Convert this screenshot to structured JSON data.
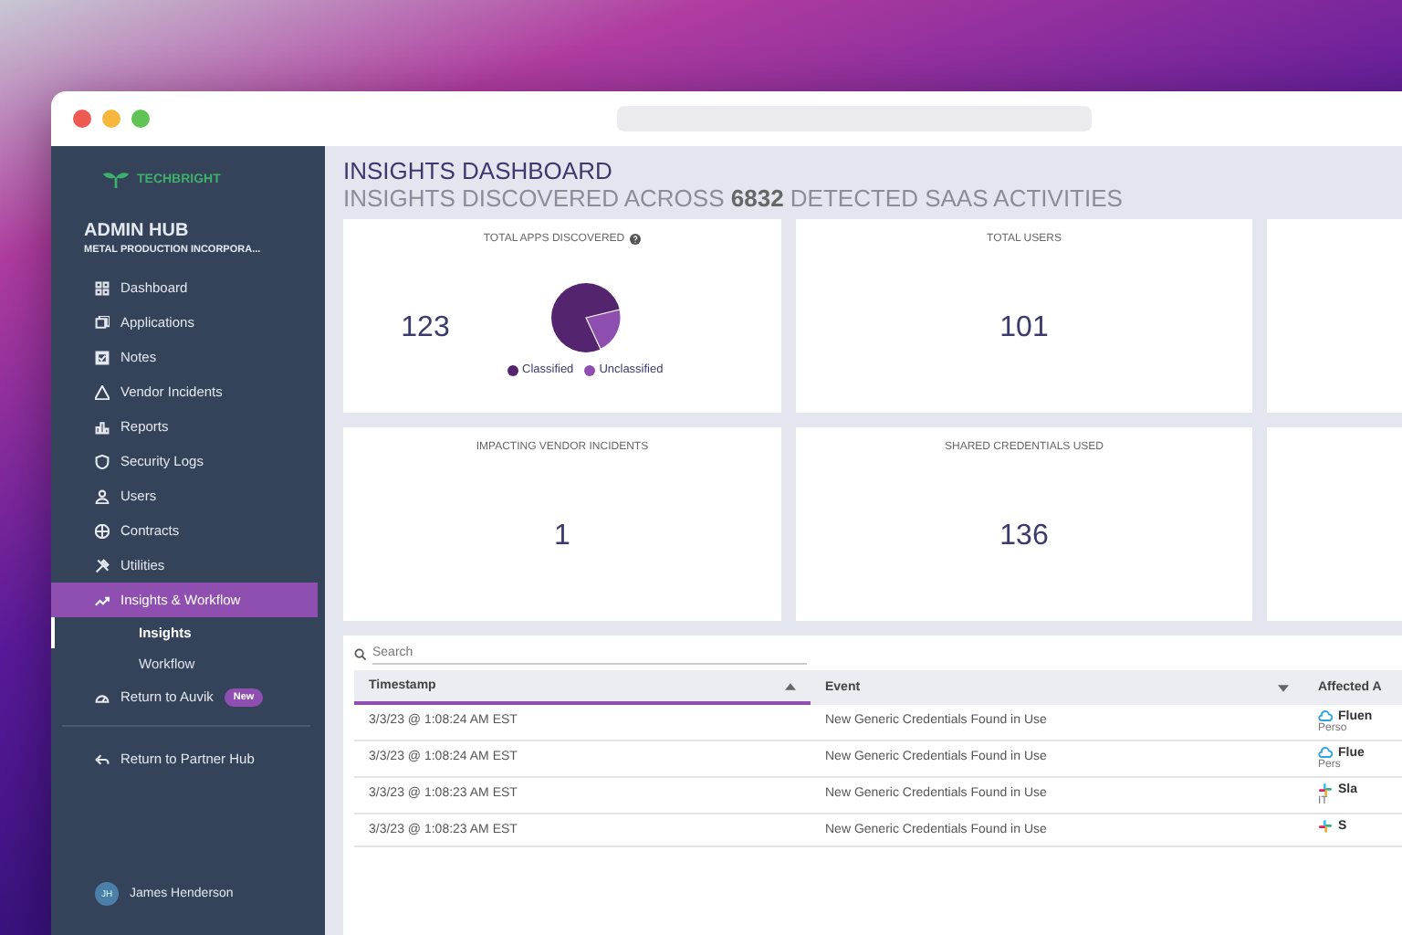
{
  "browser": {
    "dots": [
      {
        "color": "#ee5a52"
      },
      {
        "color": "#f5b73c"
      },
      {
        "color": "#5fc454"
      }
    ]
  },
  "sidebar": {
    "brand": "TECHBRIGHT",
    "hub": "ADMIN HUB",
    "org": "METAL PRODUCTION INCORPORA...",
    "items": [
      {
        "label": "Dashboard",
        "selected": false
      },
      {
        "label": "Applications",
        "selected": false
      },
      {
        "label": "Notes",
        "selected": false
      },
      {
        "label": "Vendor Incidents",
        "selected": false
      },
      {
        "label": "Reports",
        "selected": false
      },
      {
        "label": "Security Logs",
        "selected": false
      },
      {
        "label": "Users",
        "selected": false
      },
      {
        "label": "Contracts",
        "selected": false
      },
      {
        "label": "Utilities",
        "selected": false
      },
      {
        "label": "Insights & Workflow",
        "selected": true,
        "children": [
          {
            "label": "Insights",
            "selected": true
          },
          {
            "label": "Workflow",
            "selected": false
          }
        ]
      },
      {
        "label": "Return to Auvik",
        "selected": false,
        "badge": "New"
      }
    ],
    "footer_items": [
      {
        "label": "Return to Partner Hub",
        "selected": false
      }
    ],
    "user": {
      "initials": "JH",
      "name": "James Henderson"
    }
  },
  "main": {
    "title": "INSIGHTS DASHBOARD",
    "subtitle": "INSIGHTS DISCOVERED ACROSS **6832** DETECTED SAAS ACTIVITIES",
    "cards": [
      {
        "kind": "pie",
        "label": "TOTAL APPS DISCOVERED",
        "value": "123",
        "legend": [
          {
            "label": "Classified",
            "color": "#55246f"
          },
          {
            "label": "Unclassified",
            "color": "#8e4fb0"
          }
        ]
      },
      {
        "kind": "stat",
        "label": "TOTAL USERS",
        "value": "101"
      },
      {
        "kind": "stat",
        "label": "IMPACTING VENDOR INCIDENTS",
        "value": "1"
      },
      {
        "kind": "stat",
        "label": "SHARED CREDENTIALS USED",
        "value": "136"
      }
    ]
  },
  "table": {
    "search": {
      "placeholder": "Search"
    },
    "columns": [
      {
        "label": "Timestamp"
      },
      {
        "label": "Event"
      },
      {
        "label": "Affected A"
      }
    ],
    "rows": [
      {
        "timestamp": "3/3/23 @ 1:08:24 AM EST",
        "event": "New Generic Credentials Found in Use",
        "app": "Fluen",
        "sub": "Perso"
      },
      {
        "timestamp": "3/3/23 @ 1:08:24 AM EST",
        "event": "New Generic Credentials Found in Use",
        "app": "Flue",
        "sub": "Pers"
      },
      {
        "timestamp": "3/3/23 @ 1:08:23 AM EST",
        "event": "New Generic Credentials Found in Use",
        "app": "Sla",
        "sub": "IT"
      },
      {
        "timestamp": "3/3/23 @ 1:08:23 AM EST",
        "event": "New Generic Credentials Found in Use",
        "app": "S"
      }
    ]
  }
}
